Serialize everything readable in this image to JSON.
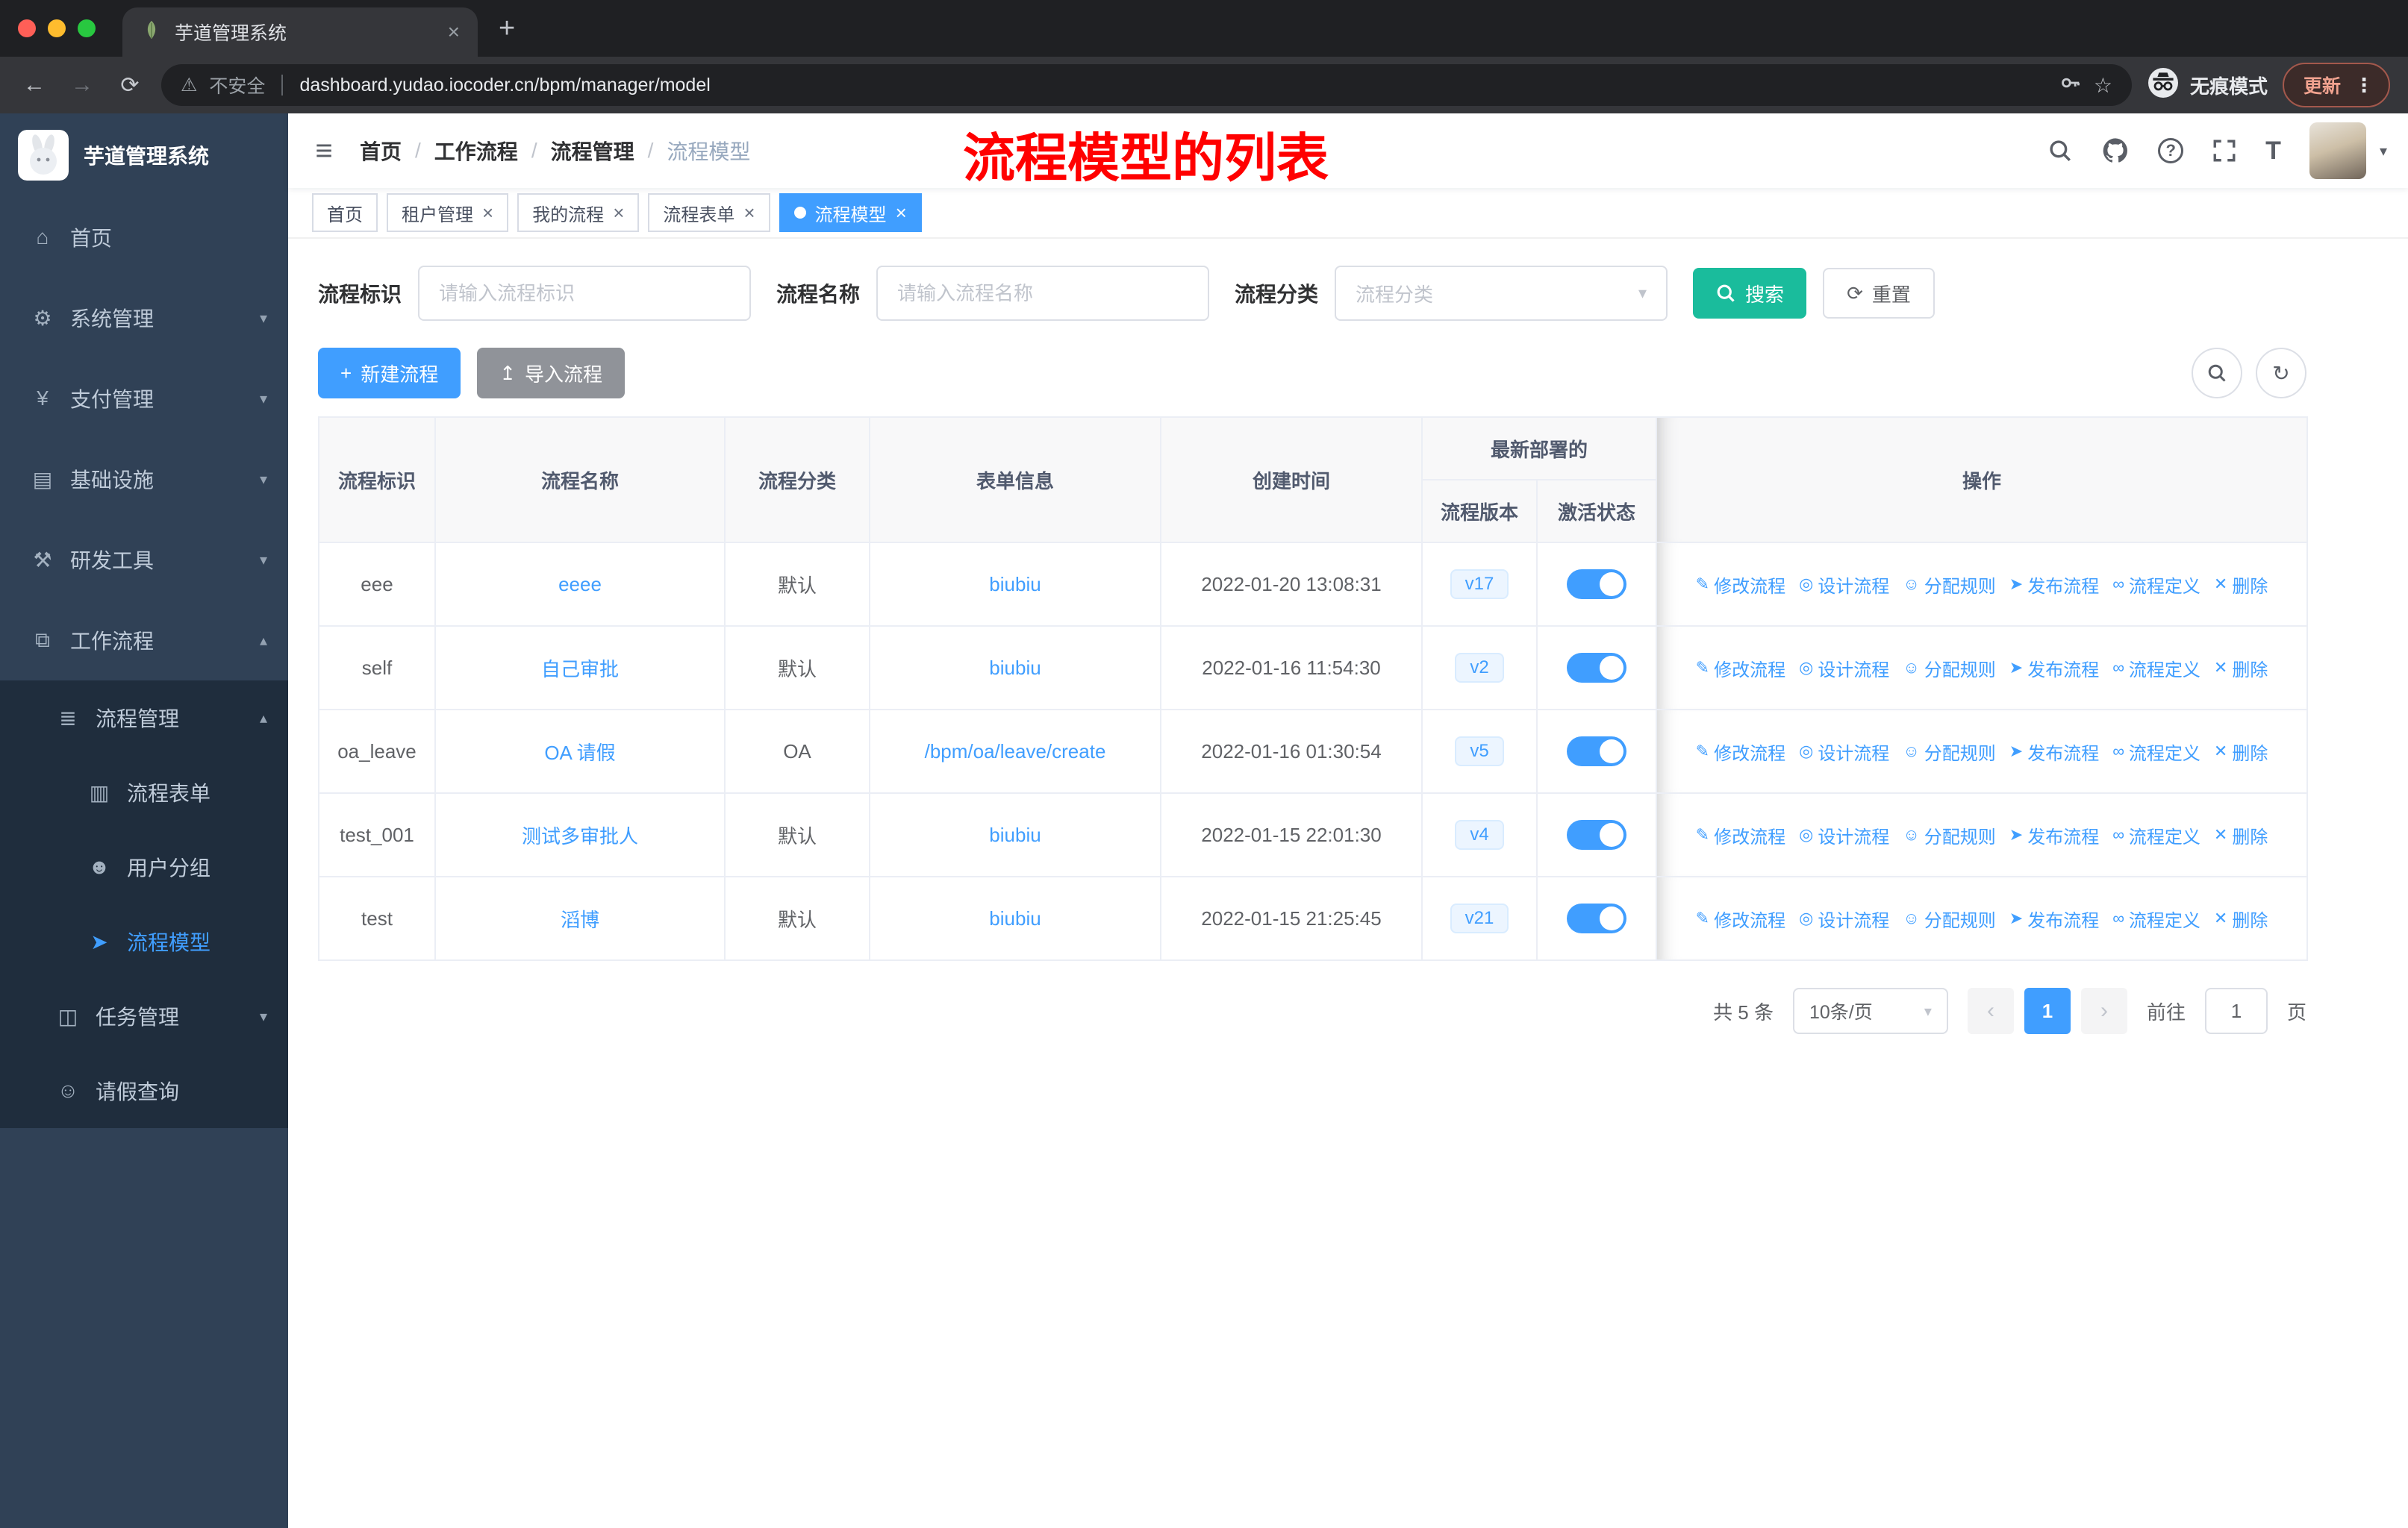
{
  "colors": {
    "accent": "#409EFF",
    "search_button": "#1ABC9C",
    "annotation_red": "#FF0000",
    "sidebar_bg": "#304156",
    "submenu_bg": "#1F2D3D",
    "badge_bg": "#ECF5FF"
  },
  "icons": {
    "close": "×",
    "new_tab": "+",
    "back": "←",
    "forward": "→",
    "reload": "⟳",
    "warning": "⚠",
    "star": "☆",
    "kebab": "⋮",
    "hamburger": "≡",
    "question": "?",
    "font_size": "T",
    "chevron_down": "▾",
    "chevron_up": "▴",
    "home": "⌂",
    "system": "⚙",
    "payment": "¥",
    "infra": "▤",
    "tools": "⚒",
    "workflow": "⧉",
    "process_mgmt": "≣",
    "form": "▥",
    "user_group": "☻",
    "model": "➤",
    "task": "◫",
    "leave": "☺",
    "plus": "+",
    "upload": "↥",
    "refresh": "↻",
    "reset": "⟳",
    "prev": "‹",
    "next": "›",
    "edit": "✎",
    "design": "◎",
    "assign": "☺",
    "publish": "➤",
    "definition": "∞",
    "delete": "✕"
  },
  "browser": {
    "tab_title": "芋道管理系统",
    "security": "不安全",
    "url": "dashboard.yudao.iocoder.cn/bpm/manager/model",
    "incognito": "无痕模式",
    "update": "更新"
  },
  "sidebar": {
    "title": "芋道管理系统",
    "menu": [
      "首页",
      "系统管理",
      "支付管理",
      "基础设施",
      "研发工具",
      "工作流程",
      "流程管理",
      "流程表单",
      "用户分组",
      "流程模型",
      "任务管理",
      "请假查询"
    ]
  },
  "header": {
    "breadcrumb": [
      "首页",
      "工作流程",
      "流程管理",
      "流程模型"
    ],
    "sep": "/",
    "annotation": "流程模型的列表"
  },
  "tabs": [
    "首页",
    "租户管理",
    "我的流程",
    "流程表单",
    "流程模型"
  ],
  "filters": {
    "process_id_label": "流程标识",
    "process_id_placeholder": "请输入流程标识",
    "process_name_label": "流程名称",
    "process_name_placeholder": "请输入流程名称",
    "category_label": "流程分类",
    "category_placeholder": "流程分类",
    "search_label": "搜索",
    "reset_label": "重置"
  },
  "toolbar": {
    "create_label": "新建流程",
    "import_label": "导入流程"
  },
  "table": {
    "headers": {
      "process_id": "流程标识",
      "process_name": "流程名称",
      "category": "流程分类",
      "form_info": "表单信息",
      "create_time": "创建时间",
      "deploy_group": "最新部署的",
      "version": "流程版本",
      "active_status": "激活状态",
      "actions": "操作"
    },
    "actions": [
      "修改流程",
      "设计流程",
      "分配规则",
      "发布流程",
      "流程定义",
      "删除"
    ],
    "rows": [
      {
        "id": "eee",
        "name": "eeee",
        "category": "默认",
        "form": "biubiu",
        "created": "2022-01-20 13:08:31",
        "version": "v17"
      },
      {
        "id": "self",
        "name": "自己审批",
        "category": "默认",
        "form": "biubiu",
        "created": "2022-01-16 11:54:30",
        "version": "v2"
      },
      {
        "id": "oa_leave",
        "name": "OA 请假",
        "category": "OA",
        "form": "/bpm/oa/leave/create",
        "created": "2022-01-16 01:30:54",
        "version": "v5"
      },
      {
        "id": "test_001",
        "name": "测试多审批人",
        "category": "默认",
        "form": "biubiu",
        "created": "2022-01-15 22:01:30",
        "version": "v4"
      },
      {
        "id": "test",
        "name": "滔博",
        "category": "默认",
        "form": "biubiu",
        "created": "2022-01-15 21:25:45",
        "version": "v21"
      }
    ]
  },
  "pagination": {
    "total": "共 5 条",
    "page_size": "10条/页",
    "page": "1",
    "goto": "前往",
    "goto_value": "1",
    "unit": "页"
  }
}
